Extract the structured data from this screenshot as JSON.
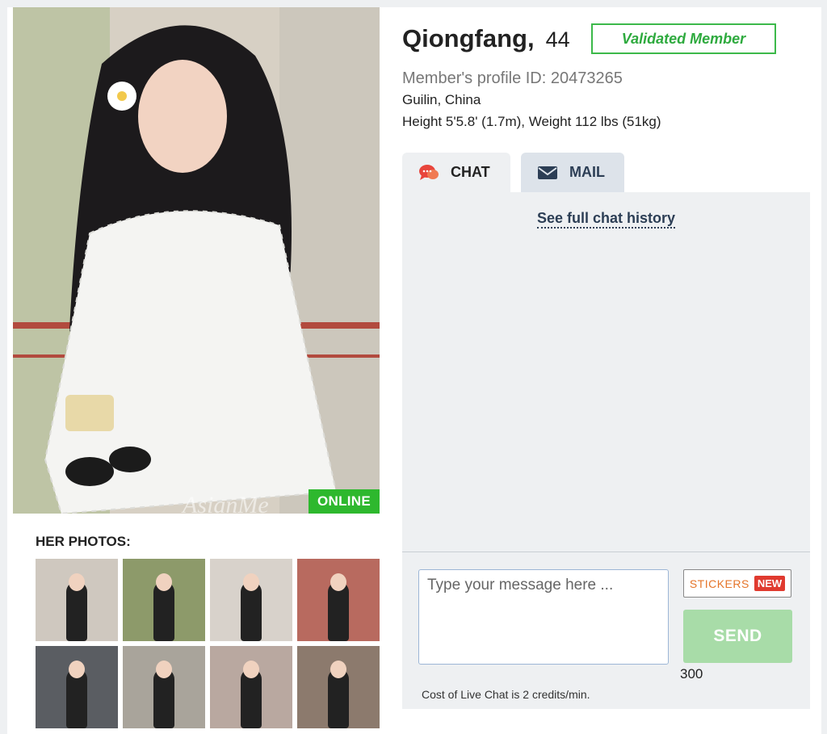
{
  "profile": {
    "name": "Qiongfang,",
    "age": "44",
    "validated": "Validated Member",
    "profile_id": "Member's profile ID: 20473265",
    "location": "Guilin, China",
    "height_weight": "Height 5'5.8' (1.7m), Weight 112 lbs (51kg)"
  },
  "photo": {
    "status": "ONLINE",
    "watermark": "AsianMe"
  },
  "photos_section": {
    "title": "HER PHOTOS:",
    "thumbnails": [
      {
        "bg": "#cfc8bf"
      },
      {
        "bg": "#8d9a6a"
      },
      {
        "bg": "#d8d2cb"
      },
      {
        "bg": "#b86a5f"
      },
      {
        "bg": "#5a5d62"
      },
      {
        "bg": "#a9a49b"
      },
      {
        "bg": "#b9a8a0"
      },
      {
        "bg": "#8c7a6d"
      }
    ]
  },
  "tabs": {
    "chat": {
      "label": "CHAT",
      "icon": "chat-bubbles-icon"
    },
    "mail": {
      "label": "MAIL",
      "icon": "envelope-icon"
    }
  },
  "chat": {
    "history_link": "See full chat history",
    "input_placeholder": "Type your message here ...",
    "stickers_label": "STICKERS",
    "new_badge": "NEW",
    "send_label": "SEND",
    "char_count": "300",
    "cost_text": "Cost of Live Chat is 2 credits/min."
  },
  "colors": {
    "online_green": "#2eb82e",
    "validated_green": "#3cb94a",
    "send_disabled": "#a8dca8",
    "new_red": "#e03a2f",
    "stickers_orange": "#e5752a",
    "tab_active_bg": "#eef0f2",
    "tab_inactive_bg": "#dde3ea"
  }
}
